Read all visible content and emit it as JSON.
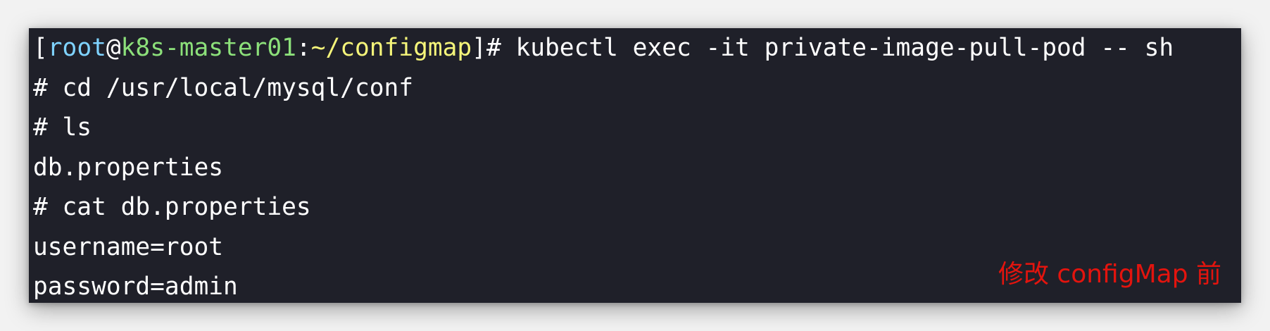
{
  "prompt": {
    "open_bracket": "[",
    "user": "root",
    "at": "@",
    "host": "k8s-master01",
    "colon": ":",
    "path": "~/configmap",
    "close": "]# ",
    "command": "kubectl exec -it private-image-pull-pod -- sh"
  },
  "lines": [
    "# cd /usr/local/mysql/conf",
    "# ls",
    "db.properties",
    "# cat db.properties",
    "username=root",
    "password=admin"
  ],
  "annotation": "修改 configMap 前",
  "colors": {
    "background": "#1f2029",
    "user": "#7fd3ff",
    "host": "#8ce07a",
    "path": "#f5f57a",
    "annotation": "#e3140e"
  }
}
